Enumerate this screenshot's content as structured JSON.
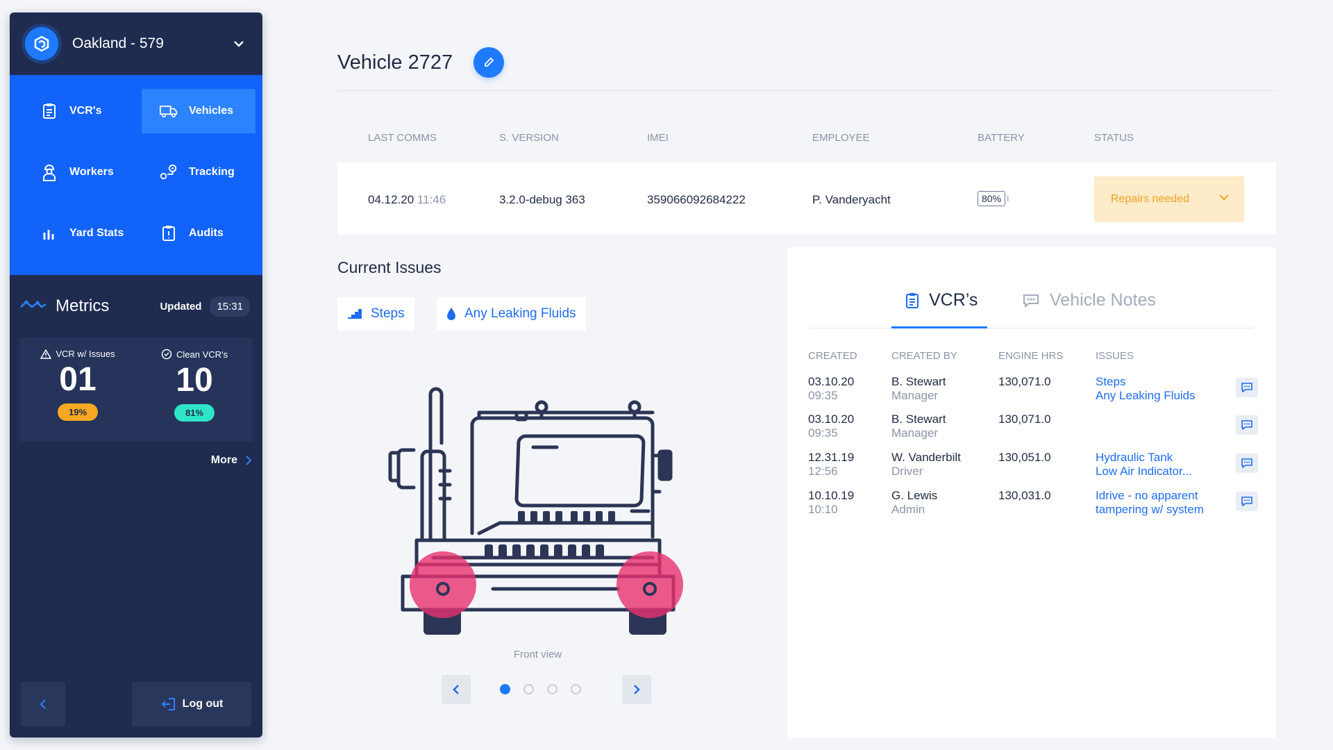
{
  "sidebar": {
    "location": "Oakland - 579",
    "nav": [
      {
        "label": "VCR's"
      },
      {
        "label": "Vehicles"
      },
      {
        "label": "Workers"
      },
      {
        "label": "Tracking"
      },
      {
        "label": "Yard Stats"
      },
      {
        "label": "Audits"
      }
    ],
    "metrics": {
      "title": "Metrics",
      "updated_label": "Updated",
      "updated_time": "15:31",
      "issues_label": "VCR w/ Issues",
      "issues_count": "01",
      "issues_pct": "19%",
      "clean_label": "Clean VCR's",
      "clean_count": "10",
      "clean_pct": "81%",
      "more_label": "More"
    },
    "logout_label": "Log out"
  },
  "header": {
    "title": "Vehicle 2727"
  },
  "info": {
    "headers": [
      "LAST COMMS",
      "S. VERSION",
      "IMEI",
      "EMPLOYEE",
      "BATTERY",
      "STATUS"
    ],
    "last_comms_date": "04.12.20",
    "last_comms_time": "11:46",
    "version": "3.2.0-debug 363",
    "imei": "359066092684222",
    "employee": "P. Vanderyacht",
    "battery": "80%",
    "status": "Repairs needed"
  },
  "issues": {
    "title": "Current Issues",
    "chips": [
      "Steps",
      "Any Leaking Fluids"
    ],
    "view_label": "Front view",
    "current_slide": 1,
    "total_slides": 4
  },
  "vcr_panel": {
    "tabs": [
      "VCR’s",
      "Vehicle Notes"
    ],
    "headers": [
      "CREATED",
      "CREATED BY",
      "ENGINE HRS",
      "ISSUES"
    ],
    "rows": [
      {
        "date": "03.10.20",
        "time": "09:35",
        "name": "B. Stewart",
        "role": "Manager",
        "hours": "130,071.0",
        "issue1": "Steps",
        "issue2": "Any Leaking Fluids"
      },
      {
        "date": "03.10.20",
        "time": "09:35",
        "name": "B. Stewart",
        "role": "Manager",
        "hours": "130,071.0",
        "issue1": "",
        "issue2": ""
      },
      {
        "date": "12.31.19",
        "time": "12:56",
        "name": "W. Vanderbilt",
        "role": "Driver",
        "hours": "130,051.0",
        "issue1": "Hydraulic Tank",
        "issue2": "Low Air Indicator..."
      },
      {
        "date": "10.10.19",
        "time": "10:10",
        "name": "G. Lewis",
        "role": "Admin",
        "hours": "130,031.0",
        "issue1": "Idrive - no apparent",
        "issue2": "tampering w/ system"
      }
    ]
  },
  "colors": {
    "sidebar_bg": "#1f2c4f",
    "nav_bg": "#1163f9",
    "accent": "#1e7bff",
    "issue_badge": "#f7a823",
    "clean_badge": "#2ee6c7",
    "status_bg": "#fdebc9",
    "status_text": "#f0a31e",
    "hotspot": "#e8326f"
  }
}
